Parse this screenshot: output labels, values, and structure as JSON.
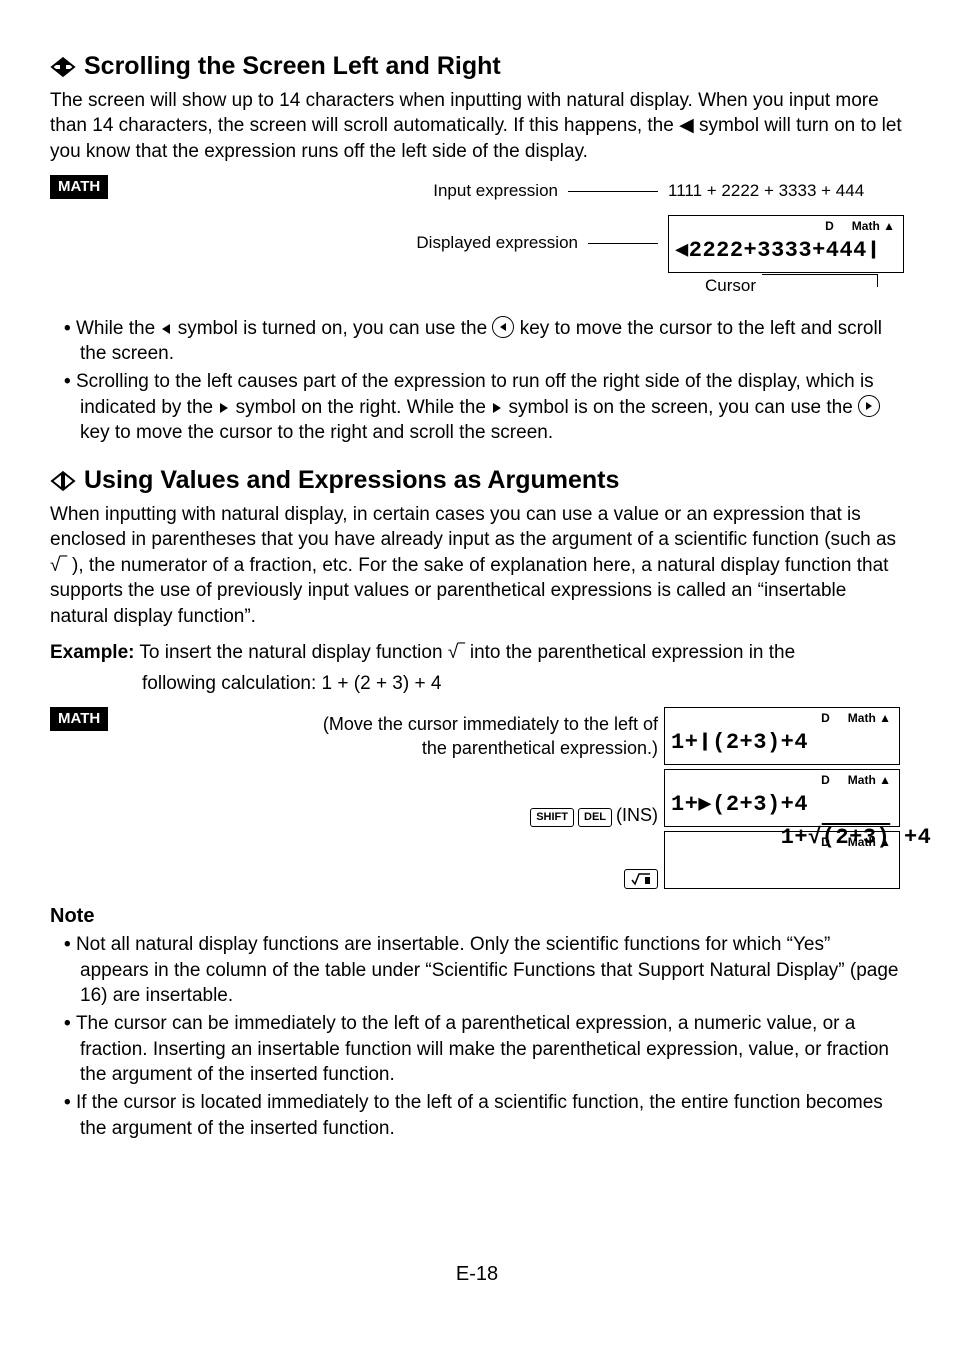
{
  "section1": {
    "title": "Scrolling the Screen Left and Right",
    "intro": "The screen will show up to 14 characters when inputting with natural display. When you input more than 14 characters, the screen will scroll automatically. If this happens, the ◀ symbol will turn on to let you know that the expression runs off the left side of the display.",
    "badge": "MATH",
    "label_input": "Input expression",
    "input_expr": "1111 + 2222 + 3333 + 444",
    "label_displayed": "Displayed expression",
    "lcd_annun_d": "D",
    "lcd_annun_math": "Math ▲",
    "lcd_text": "◀2222+3333+444❙",
    "label_cursor": "Cursor",
    "bullet1a": "While the ",
    "bullet1b": " symbol is turned on, you can use the ",
    "bullet1c": " key to move the cursor to the left and scroll the screen.",
    "bullet2a": "Scrolling to the left causes part of the expression to run off the right side of the display, which is indicated by the ",
    "bullet2b": " symbol on the right. While the ",
    "bullet2c": " symbol is on the screen, you can use the ",
    "bullet2d": " key to move the cursor to the right and scroll scroll the screen."
  },
  "section2": {
    "title": "Using Values and Expressions as Arguments",
    "intro": "When inputting with natural display, in certain cases you can use a value or an expression that is enclosed in parentheses that you have already input as the argument of a scientific function (such as √‾ ), the numerator of a fraction, etc. For the sake of explanation here, a natural display function that supports the use of previously input values or parenthetical expressions is called an “insertable natural display function”.",
    "example_label": "Example:",
    "example_line1": "To insert the natural display function √‾  into the parenthetical expression in the",
    "example_line2": "following calculation: 1 + (2 + 3) + 4",
    "badge": "MATH",
    "step1_text1": "(Move the cursor immediately to the left of",
    "step1_text2": "the parenthetical expression.)",
    "step1_lcd": "1+❙(2+3)+4",
    "step2_key1": "SHIFT",
    "step2_key2": "DEL",
    "step2_paren": "(INS)",
    "step2_lcd": "1+▶(2+3)+4",
    "step3_lcd_a": "1+√",
    "step3_lcd_b": "(2+3)",
    "step3_lcd_c": " +4",
    "lcd_annun_d": "D",
    "lcd_annun_math": "Math ▲"
  },
  "note": {
    "head": "Note",
    "n1": "Not all natural display functions are insertable. Only the scientific functions for which “Yes” appears in the column of the table under “Scientific Functions that Support Natural Display” (page 16) are insertable.",
    "n2": "The cursor can be immediately to the left of a parenthetical expression, a numeric value, or a fraction. Inserting an insertable function will make the parenthetical expression, value, or fraction the argument of the inserted function.",
    "n3": "If the cursor is located immediately to the left of a scientific function, the entire function becomes the argument of the inserted function."
  },
  "page": "E-18"
}
